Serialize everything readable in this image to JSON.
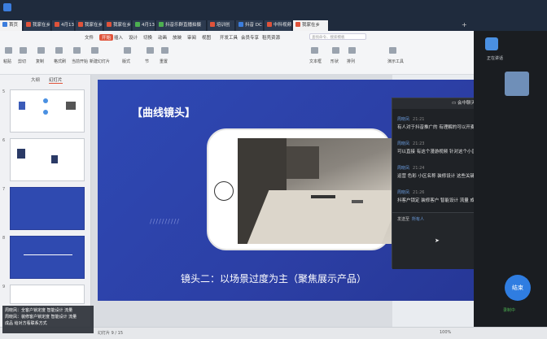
{
  "tabs": [
    {
      "label": "首页",
      "active": true,
      "color": "#3b7ddd"
    },
    {
      "label": "我家在乡",
      "active": false,
      "color": "#e0533a"
    },
    {
      "label": "4月13日",
      "active": false,
      "color": "#e0533a"
    },
    {
      "label": "我家在乡",
      "active": false,
      "color": "#e0533a"
    },
    {
      "label": "我家在乡",
      "active": false,
      "color": "#e0533a"
    },
    {
      "label": "4月13日",
      "active": false,
      "color": "#4caf50"
    },
    {
      "label": "抖音乐群直播拍摄",
      "active": false,
      "color": "#4caf50"
    },
    {
      "label": "培训创",
      "active": false,
      "color": "#e0533a"
    },
    {
      "label": "抖音 DC",
      "active": false,
      "color": "#3b7ddd"
    },
    {
      "label": "中科视频",
      "active": false,
      "color": "#e0533a"
    },
    {
      "label": "我家在乡",
      "active": true,
      "color": "#e0533a"
    }
  ],
  "menu": [
    "文件",
    "开始",
    "插入",
    "设计",
    "切换",
    "动画",
    "放映",
    "审阅",
    "视图",
    "开发工具",
    "会员专享",
    "稻壳资源"
  ],
  "search_placeholder": "查找命令、搜索模板",
  "ribbon_buttons": [
    "粘贴",
    "剪切",
    "复制",
    "格式刷",
    "当前开始",
    "新建幻灯片",
    "版式",
    "节",
    "重置",
    "文本框",
    "形状",
    "排列",
    "演示工具"
  ],
  "sidebar_tabs": [
    "大纲",
    "幻灯片"
  ],
  "slide_numbers": [
    "5",
    "6",
    "7",
    "8",
    "9"
  ],
  "slide": {
    "title": "【曲线镜头】",
    "caption": "镜头二：以场景过度为主（聚焦展示产品）"
  },
  "chat": {
    "title": "会中聊天",
    "messages": [
      {
        "name": "周晓凤",
        "time": "21:21",
        "text": "有人对于抖音推广的 有理解的可以开麦"
      },
      {
        "name": "周晓凤",
        "time": "21:23",
        "text": "可以直接 有这个漫游视频 针对这个小区做这么的 抖加投放"
      },
      {
        "name": "周晓凤",
        "time": "21:24",
        "text": "运营 色彩 小区名称 装修设计 这些关键词创作+投放"
      },
      {
        "name": "周晓凤",
        "time": "21:26",
        "text": "抖客户锁定 装修客户 智能设计 流量 成品 给对方看联系方式"
      }
    ],
    "send_to_label": "发送至",
    "send_to_value": "所有人"
  },
  "right_panel": {
    "status": "正在讲话",
    "end_button": "结束",
    "bottom_status": "录制中"
  },
  "tooltip_lines": [
    "周晓凤：全客户锁定度 智能设计 流量",
    "周晓凤：装修客户锁定度 智能设计 流量",
    "成品 给对方看联系方式"
  ],
  "status_bar": {
    "left": "幻灯片 9 / 15",
    "right": "100%"
  }
}
